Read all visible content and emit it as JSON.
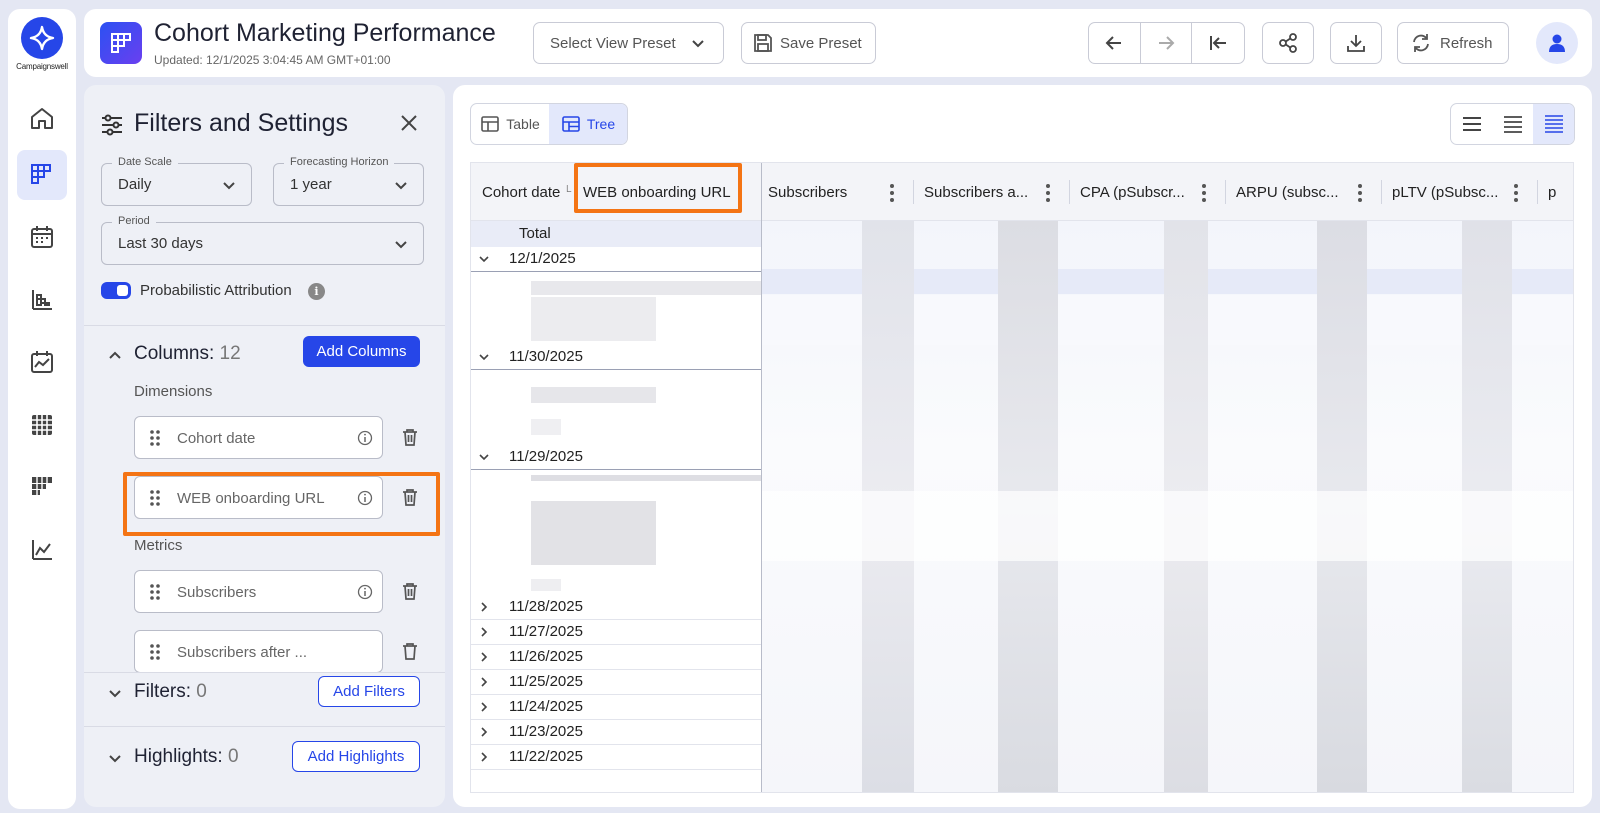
{
  "brand": {
    "name": "Campaignswell"
  },
  "rail": {
    "items": [
      {
        "name": "home"
      },
      {
        "name": "cohort-performance",
        "active": true
      },
      {
        "name": "calendar"
      },
      {
        "name": "reports"
      },
      {
        "name": "daily-report"
      },
      {
        "name": "grid-view"
      },
      {
        "name": "funnel"
      },
      {
        "name": "analytics"
      }
    ]
  },
  "header": {
    "title": "Cohort Marketing Performance",
    "updated": "Updated: 12/1/2025 3:04:45 AM GMT+01:00",
    "preset_placeholder": "Select View Preset",
    "save_preset": "Save Preset",
    "refresh": "Refresh"
  },
  "filters_panel": {
    "title": "Filters and Settings",
    "date_scale": {
      "label": "Date Scale",
      "value": "Daily"
    },
    "forecast_horizon": {
      "label": "Forecasting Horizon",
      "value": "1 year"
    },
    "period": {
      "label": "Period",
      "value": "Last 30 days"
    },
    "probabilistic_attribution": {
      "label": "Probabilistic Attribution",
      "enabled": true
    },
    "columns": {
      "title": "Columns:",
      "count": "12",
      "add_label": "Add Columns",
      "dimensions_label": "Dimensions",
      "dimensions": [
        "Cohort date",
        "WEB onboarding URL"
      ],
      "metrics_label": "Metrics",
      "metrics": [
        "Subscribers",
        "Subscribers after ..."
      ]
    },
    "filters": {
      "title": "Filters:",
      "count": "0",
      "add_label": "Add Filters"
    },
    "highlights": {
      "title": "Highlights:",
      "count": "0",
      "add_label": "Add Highlights"
    }
  },
  "main": {
    "view_tabs": [
      {
        "label": "Table",
        "active": false
      },
      {
        "label": "Tree",
        "active": true
      }
    ],
    "grid": {
      "group_header": {
        "first": "Cohort date",
        "second": "WEB onboarding URL"
      },
      "columns": [
        "Subscribers",
        "Subscribers a...",
        "CPA (pSubscr...",
        "ARPU (subsc...",
        "pLTV (pSubsc...",
        "p"
      ],
      "total_label": "Total",
      "rows": [
        {
          "date": "12/1/2025",
          "expanded": true
        },
        {
          "date": "11/30/2025",
          "expanded": true
        },
        {
          "date": "11/29/2025",
          "expanded": true
        },
        {
          "date": "11/28/2025",
          "expanded": false
        },
        {
          "date": "11/27/2025",
          "expanded": false
        },
        {
          "date": "11/26/2025",
          "expanded": false
        },
        {
          "date": "11/25/2025",
          "expanded": false
        },
        {
          "date": "11/24/2025",
          "expanded": false
        },
        {
          "date": "11/23/2025",
          "expanded": false
        },
        {
          "date": "11/22/2025",
          "expanded": false
        }
      ]
    }
  },
  "colors": {
    "accent": "#2646e8",
    "highlight": "#f47414",
    "panel_bg": "#eef0f6"
  }
}
